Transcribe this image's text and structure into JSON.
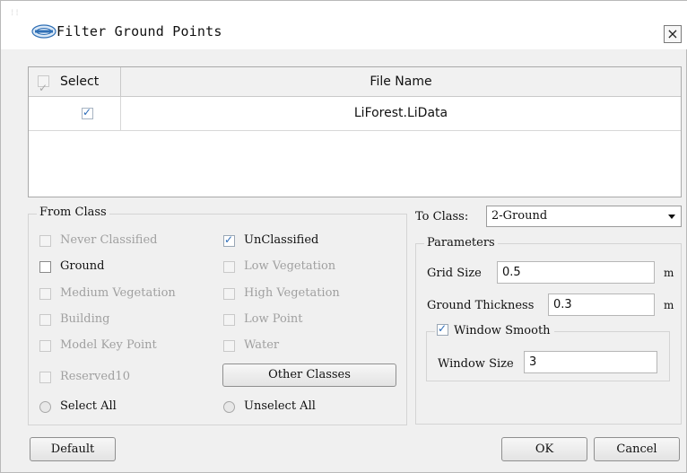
{
  "window": {
    "title": "Filter Ground Points",
    "icon": "lidar-logo-icon",
    "close_label": "×"
  },
  "file_table": {
    "headers": {
      "select": "Select",
      "file_name": "File Name"
    },
    "rows": [
      {
        "checked": true,
        "file_name": "LiForest.LiData"
      }
    ]
  },
  "from_class": {
    "legend": "From Class",
    "left_items": [
      {
        "label": "Never Classified",
        "checked": false,
        "enabled": false
      },
      {
        "label": "Ground",
        "checked": false,
        "enabled": true
      },
      {
        "label": "Medium Vegetation",
        "checked": false,
        "enabled": false
      },
      {
        "label": "Building",
        "checked": false,
        "enabled": false
      },
      {
        "label": "Model Key Point",
        "checked": false,
        "enabled": false
      },
      {
        "label": "Reserved10",
        "checked": false,
        "enabled": false
      }
    ],
    "right_items": [
      {
        "label": "UnClassified",
        "checked": true,
        "enabled": true
      },
      {
        "label": "Low Vegetation",
        "checked": false,
        "enabled": false
      },
      {
        "label": "High Vegetation",
        "checked": false,
        "enabled": false
      },
      {
        "label": "Low Point",
        "checked": false,
        "enabled": false
      },
      {
        "label": "Water",
        "checked": false,
        "enabled": false
      }
    ],
    "other_classes_button": "Other Classes",
    "select_all": "Select All",
    "unselect_all": "Unselect All"
  },
  "to_class": {
    "label": "To Class:",
    "value": "2-Ground"
  },
  "parameters": {
    "legend": "Parameters",
    "grid_size": {
      "label": "Grid Size",
      "value": "0.5",
      "unit": "m"
    },
    "ground_thickness": {
      "label": "Ground Thickness",
      "value": "0.3",
      "unit": "m"
    },
    "window_smooth": {
      "label": "Window Smooth",
      "checked": true
    },
    "window_size": {
      "label": "Window Size",
      "value": "3"
    }
  },
  "footer": {
    "default": "Default",
    "ok": "OK",
    "cancel": "Cancel"
  },
  "colors": {
    "check_accent": "#2b6bb8",
    "dialog_bg": "#f0f0f0"
  }
}
